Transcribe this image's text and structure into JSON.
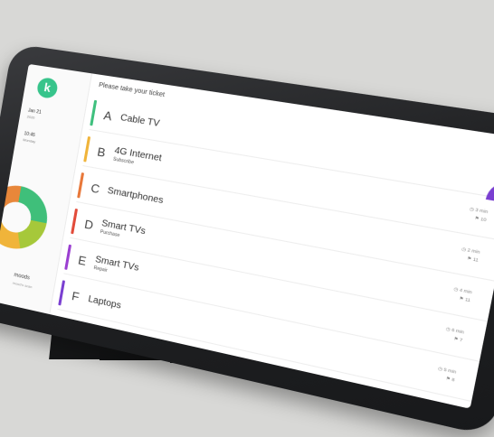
{
  "colors": {
    "brand": "#37c48b",
    "ticket_bars": [
      "#3fc07e",
      "#f0b43a",
      "#e8783a",
      "#e24b3a",
      "#9b3fd1",
      "#7a3fd1"
    ],
    "accent": "#7a3fd1"
  },
  "sidebar": {
    "logo": "k",
    "date": "Jan 21",
    "date_sub": "2020",
    "time": "10:45",
    "time_sub": "Monday",
    "moods_label": "moods",
    "moods_sub": "mood's scan"
  },
  "main": {
    "prompt": "Please take your ticket",
    "tickets": [
      {
        "letter": "A",
        "name": "Cable TV",
        "sub": "",
        "meta1": "",
        "meta2": ""
      },
      {
        "letter": "B",
        "name": "4G Internet",
        "sub": "Subscribe",
        "meta1": "◷ 3 min",
        "meta2": "⚑ 10"
      },
      {
        "letter": "C",
        "name": "Smartphones",
        "sub": "",
        "meta1": "◷ 2 min",
        "meta2": "⚑ 11"
      },
      {
        "letter": "D",
        "name": "Smart TVs",
        "sub": "Purchase",
        "meta1": "◷ 4 min",
        "meta2": "⚑ 11"
      },
      {
        "letter": "E",
        "name": "Smart TVs",
        "sub": "Repair",
        "meta1": "◷ 6 min",
        "meta2": "⚑ 7"
      },
      {
        "letter": "F",
        "name": "Laptops",
        "sub": "",
        "meta1": "◷ 5 min",
        "meta2": "⚑ 8"
      }
    ]
  }
}
